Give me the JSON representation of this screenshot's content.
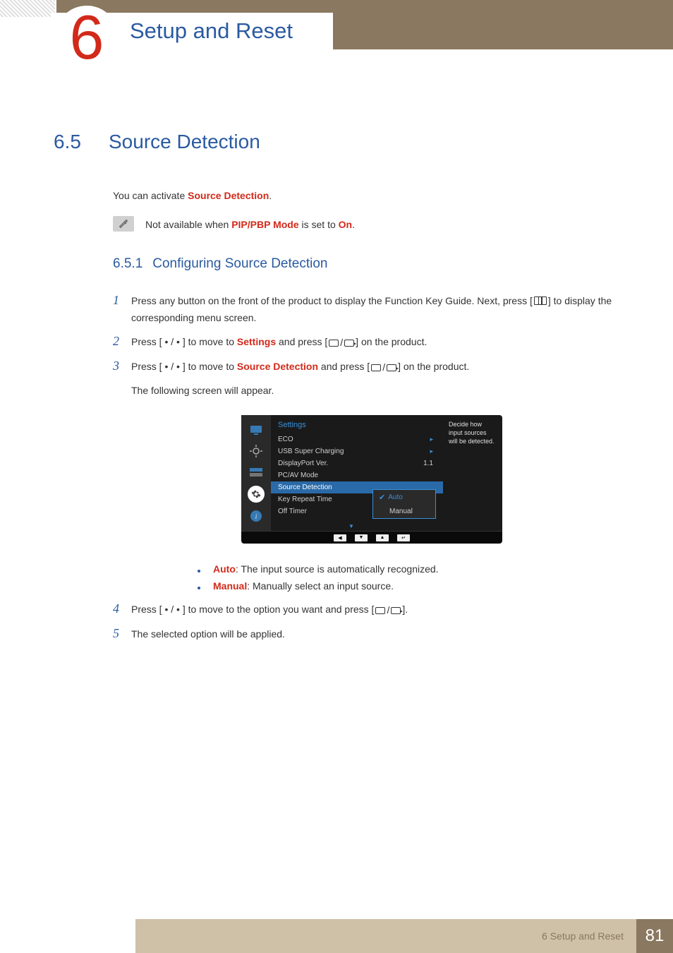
{
  "header": {
    "chapter_number": "6",
    "chapter_title": "Setup and Reset"
  },
  "section": {
    "number": "6.5",
    "title": "Source Detection",
    "intro_pre": "You can activate ",
    "intro_term": "Source Detection",
    "intro_post": ".",
    "note_pre": "Not available when ",
    "note_term1": "PIP/PBP Mode",
    "note_mid": " is set to ",
    "note_term2": "On",
    "note_post": ".",
    "subsection_number": "6.5.1",
    "subsection_title": "Configuring Source Detection"
  },
  "steps": {
    "s1_pre": "Press any button on the front of the product to display the Function Key Guide. Next, press [",
    "s1_post": "] to display the corresponding menu screen.",
    "s2_pre": "Press [",
    "s2_navdot": " • / • ",
    "s2_mid": "] to move to ",
    "s2_term": "Settings",
    "s2_mid2": " and press [",
    "s2_post": "] on the product.",
    "s3_pre": "Press [",
    "s3_mid": "] to move to ",
    "s3_term": "Source Detection",
    "s3_mid2": " and press [",
    "s3_post": "] on the product.",
    "s3_sub": "The following screen will appear.",
    "s4_pre": "Press [",
    "s4_mid": "] to move to the option you want and press [",
    "s4_post": "].",
    "s5": "The selected option will be applied."
  },
  "osd": {
    "title": "Settings",
    "items": {
      "eco": "ECO",
      "usb": "USB Super Charging",
      "dp": "DisplayPort Ver.",
      "dp_val": "1.1",
      "pcav": "PC/AV Mode",
      "srcdet": "Source Detection",
      "keyrep": "Key Repeat Time",
      "offtimer": "Off Timer"
    },
    "popup": {
      "auto": "Auto",
      "manual": "Manual"
    },
    "help": "Decide how input sources will be detected."
  },
  "bullets": {
    "auto_term": "Auto",
    "auto_text": ": The input source is automatically recognized.",
    "manual_term": "Manual",
    "manual_text": ": Manually select an input source."
  },
  "footer": {
    "chapter": "6 Setup and Reset",
    "page": "81"
  }
}
